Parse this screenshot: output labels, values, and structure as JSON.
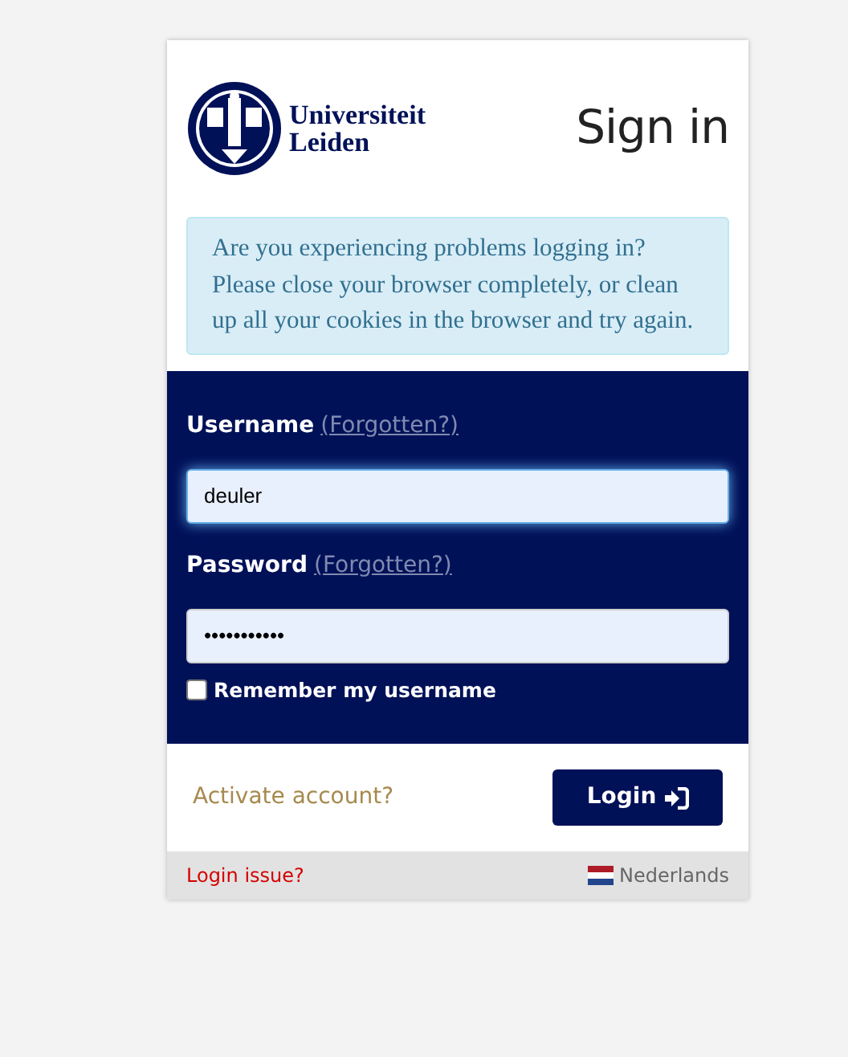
{
  "logo": {
    "line_1": "Universiteit",
    "line_2": "Leiden"
  },
  "title": "Sign in",
  "notice": "Are you experiencing problems logging in? Please close your browser completely, or clean up all your cookies in the browser and try again.",
  "fields": [
    {
      "label": "Username",
      "hint": "(Forgotten?)",
      "value": "deuler",
      "focused": true
    },
    {
      "label": "Password",
      "hint": "(Forgotten?)",
      "value": "•••••••••••",
      "focused": false
    }
  ],
  "remember": {
    "label": "Remember my username",
    "checked": false
  },
  "activate_link": "Activate account?",
  "login_button": "Login",
  "footer": {
    "issue_link": "Login issue?",
    "language": "Nederlands"
  }
}
